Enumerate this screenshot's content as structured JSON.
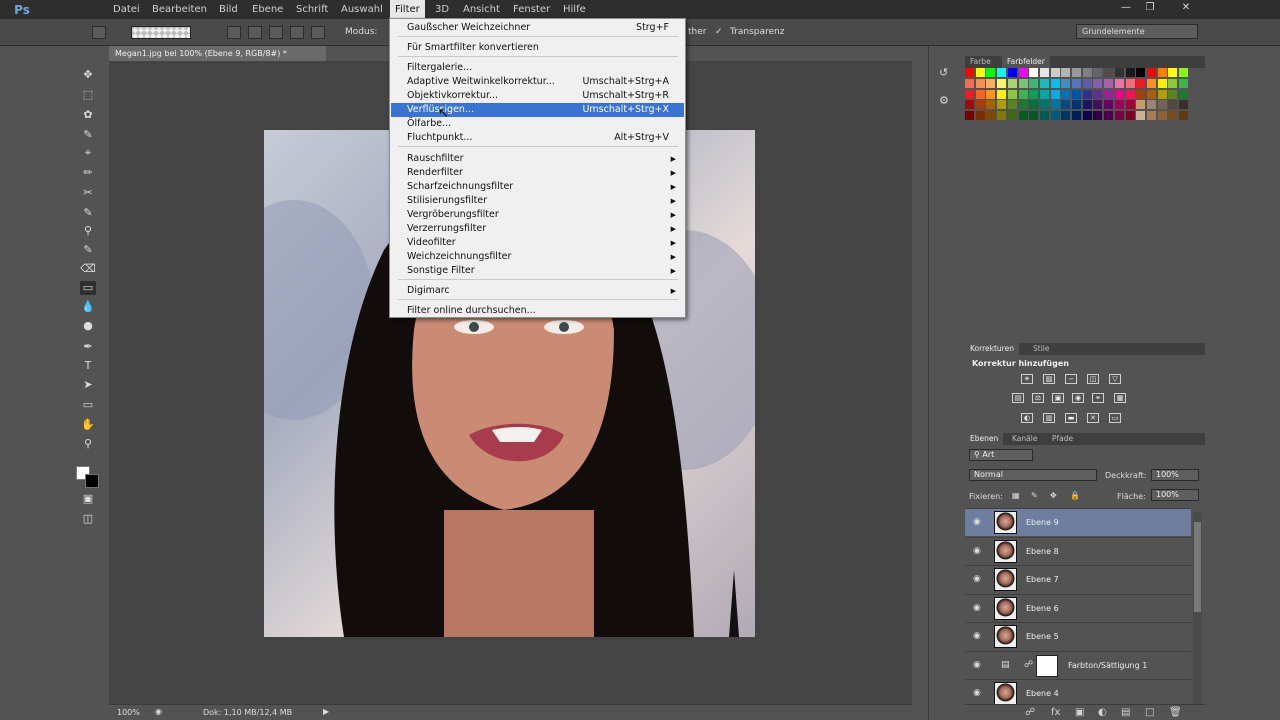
{
  "app": {
    "logo": "Ps",
    "menu": [
      "Datei",
      "Bearbeiten",
      "Bild",
      "Ebene",
      "Schrift",
      "Auswahl",
      "Filter",
      "3D",
      "Ansicht",
      "Fenster",
      "Hilfe"
    ],
    "active_menu": "Filter"
  },
  "options_bar": {
    "mode_label": "Modus:",
    "dither_label": "ther",
    "transparency_label": "Transparenz",
    "workspace": "Grundelemente"
  },
  "document": {
    "tab_title": "Megan1.jpg bei 100% (Ebene 9, RGB/8#) *",
    "zoom": "100%",
    "doc_info": "Dok: 1,10 MB/12,4 MB"
  },
  "filter_menu": {
    "items": [
      {
        "label": "Gaußscher Weichzeichner",
        "shortcut": "Strg+F"
      },
      {
        "label": "Für Smartfilter konvertieren",
        "shortcut": ""
      },
      {
        "label": "Filtergalerie...",
        "shortcut": ""
      },
      {
        "label": "Adaptive Weitwinkelkorrektur...",
        "shortcut": "Umschalt+Strg+A"
      },
      {
        "label": "Objektivkorrektur...",
        "shortcut": "Umschalt+Strg+R"
      },
      {
        "label": "Verflüssigen...",
        "shortcut": "Umschalt+Strg+X"
      },
      {
        "label": "Ölfarbe...",
        "shortcut": ""
      },
      {
        "label": "Fluchtpunkt...",
        "shortcut": "Alt+Strg+V"
      },
      {
        "label": "Rauschfilter",
        "shortcut": ""
      },
      {
        "label": "Renderfilter",
        "shortcut": ""
      },
      {
        "label": "Scharfzeichnungsfilter",
        "shortcut": ""
      },
      {
        "label": "Stilisierungsfilter",
        "shortcut": ""
      },
      {
        "label": "Vergröberungsfilter",
        "shortcut": ""
      },
      {
        "label": "Verzerrungsfilter",
        "shortcut": ""
      },
      {
        "label": "Videofilter",
        "shortcut": ""
      },
      {
        "label": "Weichzeichnungsfilter",
        "shortcut": ""
      },
      {
        "label": "Sonstige Filter",
        "shortcut": ""
      },
      {
        "label": "Digimarc",
        "shortcut": ""
      },
      {
        "label": "Filter online durchsuchen...",
        "shortcut": ""
      }
    ],
    "highlighted": "Verflüssigen..."
  },
  "panels": {
    "color_tabs": [
      "Farbe",
      "Farbfelder"
    ],
    "adjust_tabs": [
      "Korrekturen",
      "Stile"
    ],
    "adjust_title": "Korrektur hinzufügen",
    "layer_tabs": [
      "Ebenen",
      "Kanäle",
      "Pfade"
    ],
    "layer_filter": "Art",
    "blend_mode": "Normal",
    "opacity_label": "Deckkraft:",
    "opacity": "100%",
    "lock_label": "Fixieren:",
    "fill_label": "Fläche:",
    "fill": "100%",
    "layers": [
      "Ebene 9",
      "Ebene 8",
      "Ebene 7",
      "Ebene 6",
      "Ebene 5",
      "Farbton/Sättigung 1",
      "Ebene 4"
    ]
  },
  "colors": {
    "menubar": "#2e2e2e",
    "panel": "#535353",
    "highlight": "#3a73d6",
    "selected_layer": "#6d7e9e"
  }
}
